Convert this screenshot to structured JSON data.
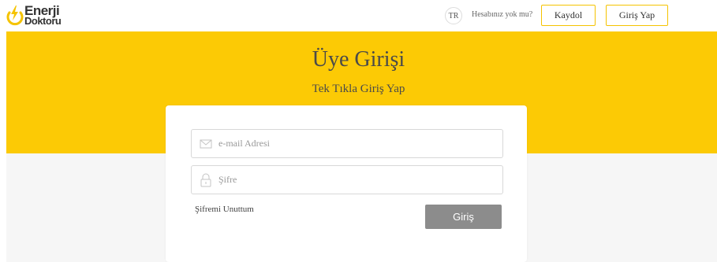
{
  "header": {
    "logo": {
      "line1": "Enerji",
      "line2": "Doktoru"
    },
    "language": "TR",
    "no_account_text": "Hesabınız yok mu?",
    "signup_label": "Kaydol",
    "login_label": "Giriş Yap"
  },
  "banner": {
    "title": "Üye Girişi",
    "subtitle": "Tek Tıkla Giriş Yap"
  },
  "form": {
    "email_placeholder": "e-mail Adresi",
    "email_value": "",
    "password_placeholder": "Şifre",
    "password_value": "",
    "forgot_label": "Şifremi Unuttum",
    "submit_label": "Giriş"
  },
  "colors": {
    "accent": "#fcca05",
    "submit": "#8c8c8c",
    "background_lower": "#f6f6f6"
  },
  "icons": [
    "energy-bolt-logo-icon",
    "mail-icon",
    "lock-icon"
  ]
}
